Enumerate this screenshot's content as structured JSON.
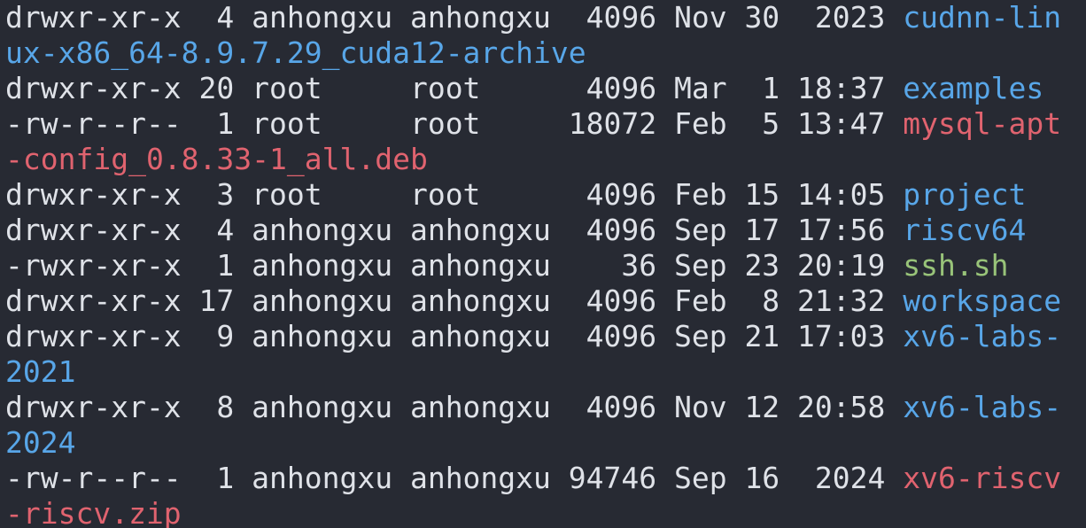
{
  "terminal": {
    "lines": [
      {
        "meta": "drwxr-xr-x  4 anhongxu anhongxu  4096 Nov 30  2023 ",
        "name": "cudnn-lin",
        "kind": "dir"
      },
      {
        "meta": "",
        "name": "ux-x86_64-8.9.7.29_cuda12-archive",
        "kind": "dir"
      },
      {
        "meta": "drwxr-xr-x 20 root     root      4096 Mar  1 18:37 ",
        "name": "examples",
        "kind": "dir"
      },
      {
        "meta": "-rw-r--r--  1 root     root     18072 Feb  5 13:47 ",
        "name": "mysql-apt",
        "kind": "deb"
      },
      {
        "meta": "",
        "name": "-config_0.8.33-1_all.deb",
        "kind": "deb"
      },
      {
        "meta": "drwxr-xr-x  3 root     root      4096 Feb 15 14:05 ",
        "name": "project",
        "kind": "dir"
      },
      {
        "meta": "drwxr-xr-x  4 anhongxu anhongxu  4096 Sep 17 17:56 ",
        "name": "riscv64",
        "kind": "dir"
      },
      {
        "meta": "-rwxr-xr-x  1 anhongxu anhongxu    36 Sep 23 20:19 ",
        "name": "ssh.sh",
        "kind": "exe"
      },
      {
        "meta": "drwxr-xr-x 17 anhongxu anhongxu  4096 Feb  8 21:32 ",
        "name": "workspace",
        "kind": "dir"
      },
      {
        "meta": "drwxr-xr-x  9 anhongxu anhongxu  4096 Sep 21 17:03 ",
        "name": "xv6-labs-",
        "kind": "dir"
      },
      {
        "meta": "",
        "name": "2021",
        "kind": "dir"
      },
      {
        "meta": "drwxr-xr-x  8 anhongxu anhongxu  4096 Nov 12 20:58 ",
        "name": "xv6-labs-",
        "kind": "dir"
      },
      {
        "meta": "",
        "name": "2024",
        "kind": "dir"
      },
      {
        "meta": "-rw-r--r--  1 anhongxu anhongxu 94746 Sep 16  2024 ",
        "name": "xv6-riscv",
        "kind": "zip"
      },
      {
        "meta": "",
        "name": "-riscv.zip",
        "kind": "zip"
      }
    ]
  },
  "colors": {
    "background": "#272a33",
    "text": "#dfe2e8",
    "directory": "#58a6e8",
    "archive": "#e0636f",
    "executable": "#98c379"
  }
}
